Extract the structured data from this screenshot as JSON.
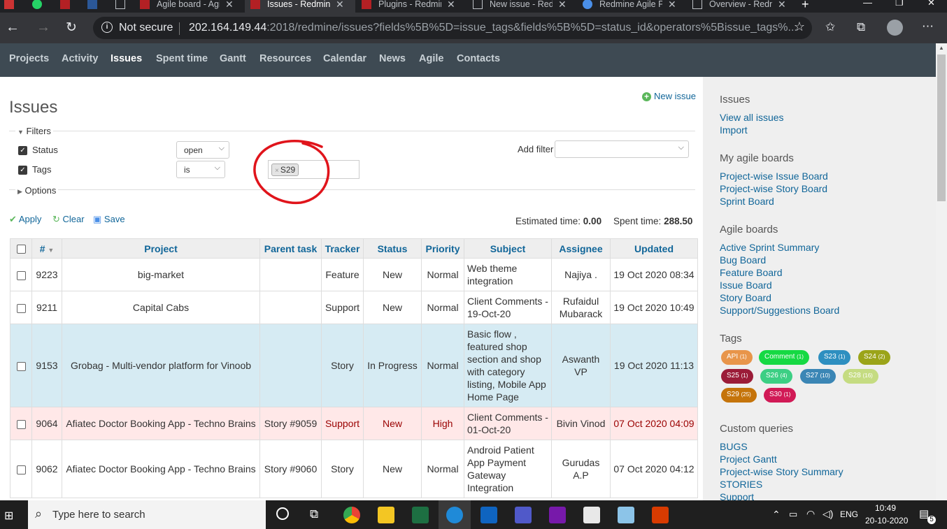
{
  "browser": {
    "tabs": [
      {
        "title": "Agile board - Agi"
      },
      {
        "title": "Issues - Redmine"
      },
      {
        "title": "Plugins - Redmine"
      },
      {
        "title": "New issue - Redm"
      },
      {
        "title": "Redmine Agile Pl"
      },
      {
        "title": "Overview - Redm"
      }
    ],
    "not_secure": "Not secure",
    "url_host": "202.164.149.44",
    "url_rest": ":2018/redmine/issues?fields%5B%5D=issue_tags&fields%5B%5D=status_id&operators%5Bissue_tags%..."
  },
  "topnav": [
    "Projects",
    "Activity",
    "Issues",
    "Spent time",
    "Gantt",
    "Resources",
    "Calendar",
    "News",
    "Agile",
    "Contacts"
  ],
  "page": {
    "title": "Issues",
    "new_issue": "New issue",
    "filters_legend": "Filters",
    "options_legend": "Options",
    "filter_status_label": "Status",
    "filter_status_op": "open",
    "filter_tags_label": "Tags",
    "filter_tags_op": "is",
    "filter_tags_value": "S29",
    "add_filter": "Add filter",
    "apply": "Apply",
    "clear": "Clear",
    "save": "Save",
    "est_label": "Estimated time:",
    "est_value": "0.00",
    "spent_label": "Spent time:",
    "spent_value": "288.50"
  },
  "table": {
    "headers": [
      "#",
      "Project",
      "Parent task",
      "Tracker",
      "Status",
      "Priority",
      "Subject",
      "Assignee",
      "Updated"
    ],
    "rows": [
      {
        "id": "9223",
        "project": "big-market",
        "parent": "",
        "tracker": "Feature",
        "status": "New",
        "priority": "Normal",
        "subject": "Web theme integration",
        "assignee": "Najiya .",
        "updated": "19 Oct 2020 08:34"
      },
      {
        "id": "9211",
        "project": "Capital Cabs",
        "parent": "",
        "tracker": "Support",
        "status": "New",
        "priority": "Normal",
        "subject": "Client Comments - 19-Oct-20",
        "assignee": "Rufaidul Mubarack",
        "updated": "19 Oct 2020 10:49"
      },
      {
        "id": "9153",
        "project": "Grobag - Multi-vendor platform for Vinoob",
        "parent": "",
        "tracker": "Story",
        "status": "In Progress",
        "priority": "Normal",
        "subject": "Basic flow , featured shop section and shop with category listing, Mobile App Home Page",
        "assignee": "Aswanth VP",
        "updated": "19 Oct 2020 11:13"
      },
      {
        "id": "9064",
        "project": "Afiatec Doctor Booking App - Techno Brains",
        "parent": "Story #9059",
        "tracker": "Support",
        "status": "New",
        "priority": "High",
        "subject": "Client Comments - 01-Oct-20",
        "assignee": "Bivin Vinod",
        "updated": "07 Oct 2020 04:09"
      },
      {
        "id": "9062",
        "project": "Afiatec Doctor Booking App - Techno Brains",
        "parent": "Story #9060",
        "tracker": "Story",
        "status": "New",
        "priority": "Normal",
        "subject": "Android Patient App Payment Gateway Integration",
        "assignee": "Gurudas A.P",
        "updated": "07 Oct 2020 04:12"
      }
    ]
  },
  "sidebar": {
    "issues_h": "Issues",
    "view_all": "View all issues",
    "import": "Import",
    "my_boards_h": "My agile boards",
    "my_boards": [
      "Project-wise Issue Board",
      "Project-wise Story Board",
      "Sprint Board"
    ],
    "boards_h": "Agile boards",
    "boards": [
      "Active Sprint Summary",
      "Bug Board",
      "Feature Board",
      "Issue Board",
      "Story Board",
      "Support/Suggestions Board"
    ],
    "tags_h": "Tags",
    "tags": [
      {
        "name": "API",
        "count": "(1)",
        "color": "#e8954a"
      },
      {
        "name": "Comment",
        "count": "(1)",
        "color": "#16d943"
      },
      {
        "name": "S23",
        "count": "(1)",
        "color": "#2e8fc0"
      },
      {
        "name": "S24",
        "count": "(2)",
        "color": "#9ba419"
      },
      {
        "name": "S25",
        "count": "(1)",
        "color": "#9b1c38"
      },
      {
        "name": "S26",
        "count": "(4)",
        "color": "#3ccf84"
      },
      {
        "name": "S27",
        "count": "(10)",
        "color": "#3b86b5"
      },
      {
        "name": "S28",
        "count": "(16)",
        "color": "#c5dc82"
      },
      {
        "name": "S29",
        "count": "(25)",
        "color": "#c5740b"
      },
      {
        "name": "S30",
        "count": "(1)",
        "color": "#d11a56"
      }
    ],
    "queries_h": "Custom queries",
    "queries": [
      "BUGS",
      "Project Gantt",
      "Project-wise Story Summary",
      "STORIES",
      "Support"
    ]
  },
  "taskbar": {
    "search_placeholder": "Type here to search",
    "lang": "ENG",
    "time": "10:49",
    "date": "20-10-2020",
    "notif": "5"
  }
}
